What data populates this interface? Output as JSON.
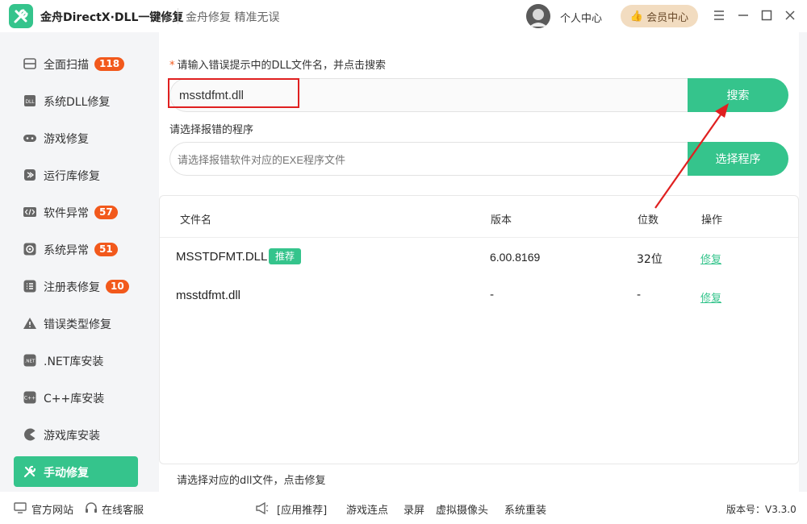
{
  "titlebar": {
    "app_title": "金舟DirectX·DLL一键修复",
    "slogan": "金舟修复 精准无误",
    "user_center": "个人中心",
    "vip_label": "会员中心"
  },
  "sidebar": {
    "items": [
      {
        "label": "全面扫描",
        "badge": "118",
        "icon": "scan-icon"
      },
      {
        "label": "系统DLL修复",
        "badge": "",
        "icon": "dll-icon"
      },
      {
        "label": "游戏修复",
        "badge": "",
        "icon": "gamepad-icon"
      },
      {
        "label": "运行库修复",
        "badge": "",
        "icon": "runtime-icon"
      },
      {
        "label": "软件异常",
        "badge": "57",
        "icon": "code-icon"
      },
      {
        "label": "系统异常",
        "badge": "51",
        "icon": "gear-icon"
      },
      {
        "label": "注册表修复",
        "badge": "10",
        "icon": "list-icon"
      },
      {
        "label": "错误类型修复",
        "badge": "",
        "icon": "warning-icon"
      },
      {
        "label": ".NET库安装",
        "badge": "",
        "icon": "net-icon"
      },
      {
        "label": "C++库安装",
        "badge": "",
        "icon": "cpp-icon"
      },
      {
        "label": "游戏库安装",
        "badge": "",
        "icon": "pacman-icon"
      },
      {
        "label": "手动修复",
        "badge": "",
        "icon": "tools-icon"
      }
    ]
  },
  "search": {
    "prompt": "请输入错误提示中的DLL文件名，并点击搜索",
    "value": "msstdfmt.dll",
    "button": "搜索"
  },
  "program": {
    "prompt": "请选择报错的程序",
    "placeholder": "请选择报错软件对应的EXE程序文件",
    "button": "选择程序"
  },
  "table": {
    "headers": {
      "name": "文件名",
      "version": "版本",
      "bits": "位数",
      "action": "操作"
    },
    "rows": [
      {
        "name": "MSSTDFMT.DLL",
        "tag": "推荐",
        "version": "6.00.8169",
        "bits": "32位",
        "action": "修复"
      },
      {
        "name": "msstdfmt.dll",
        "tag": "",
        "version": "-",
        "bits": "-",
        "action": "修复"
      }
    ]
  },
  "hint": "请选择对应的dll文件，点击修复",
  "footer": {
    "website": "官方网站",
    "support": "在线客服",
    "links": [
      "[应用推荐]",
      "游戏连点",
      "录屏",
      "虚拟摄像头",
      "系统重装"
    ],
    "version": "版本号：V3.3.0"
  },
  "colors": {
    "accent": "#35c48c",
    "badge": "#f2591c",
    "highlight": "#e02020"
  }
}
